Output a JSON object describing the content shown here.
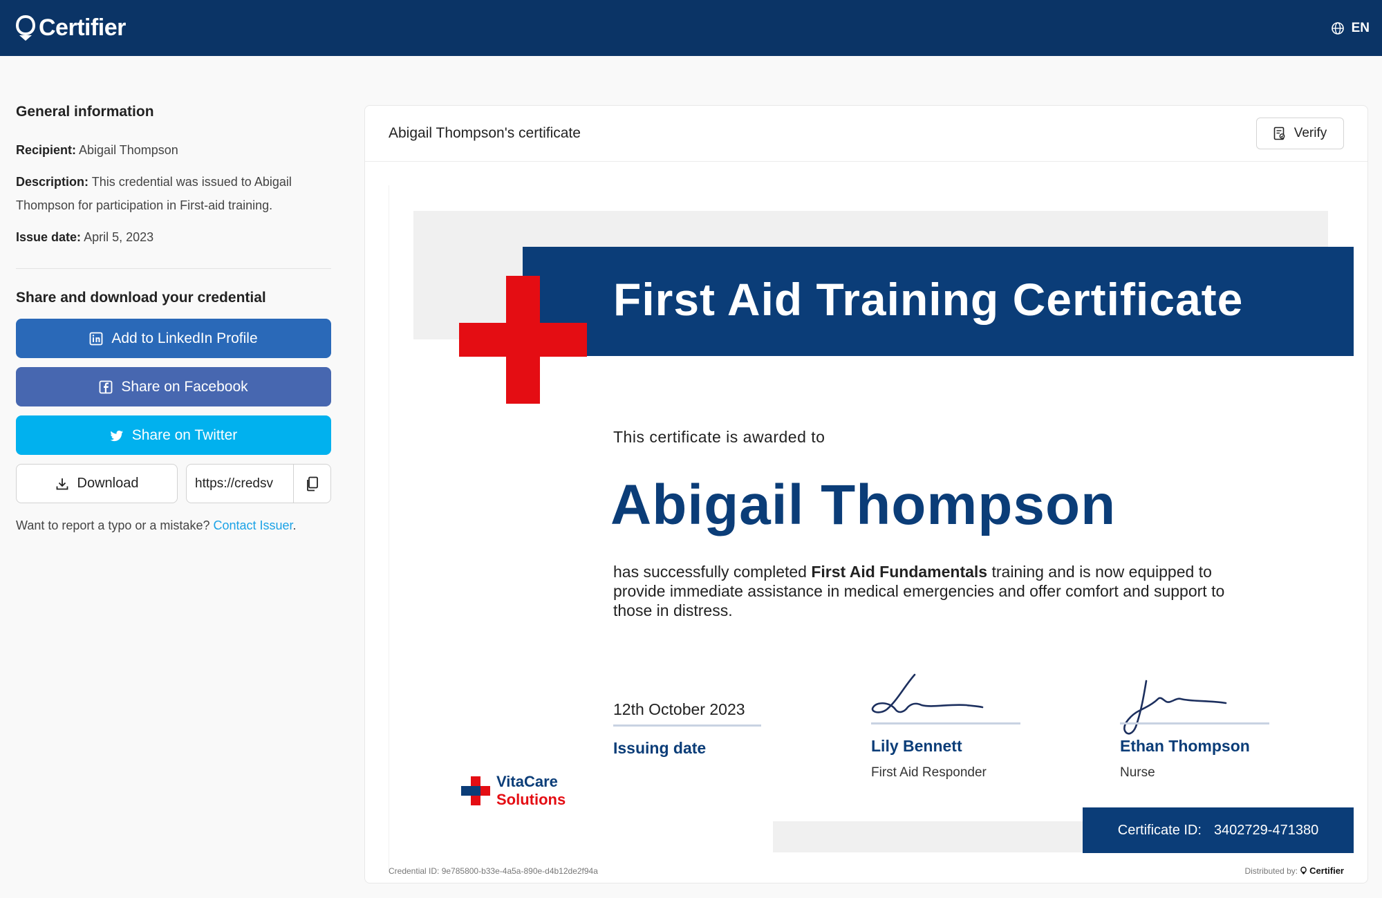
{
  "header": {
    "brand": "Certifier",
    "language": "EN",
    "icons": {
      "brand": "certifier-logo-icon",
      "language": "globe-icon"
    }
  },
  "general": {
    "title": "General information",
    "recipient_label": "Recipient:",
    "recipient_value": "Abigail Thompson",
    "description_label": "Description:",
    "description_value": "This credential was issued to Abigail Thompson for participation in First-aid training.",
    "issue_label": "Issue date:",
    "issue_value": "April 5, 2023"
  },
  "share": {
    "title": "Share and download your credential",
    "linkedin_label": "Add to LinkedIn Profile",
    "facebook_label": "Share on Facebook",
    "twitter_label": "Share on Twitter",
    "download_label": "Download",
    "url_value": "https://credsv",
    "report_text": "Want to report a typo or a mistake?",
    "report_link": "Contact Issuer",
    "report_suffix": "."
  },
  "card": {
    "title": "Abigail Thompson's certificate",
    "verify_label": "Verify"
  },
  "certificate": {
    "heading": "First Aid Training Certificate",
    "awarded": "This certificate is awarded to",
    "recipient": "Abigail Thompson",
    "body_pre": "has successfully completed ",
    "body_bold": "First Aid Fundamentals",
    "body_post": " training and is now equipped to provide immediate assistance in medical emergencies and offer comfort and support to those in distress.",
    "date_value": "12th October 2023",
    "date_label": "Issuing date",
    "signer1_name": "Lily Bennett",
    "signer1_role": "First Aid Responder",
    "signer2_name": "Ethan Thompson",
    "signer2_role": "Nurse",
    "logo_line1": "VitaCare",
    "logo_line2": "Solutions",
    "cert_id_label": "Certificate ID:",
    "cert_id_value": "3402729-471380",
    "credential_id": "Credential ID: 9e785800-b33e-4a5a-890e-d4b12de2f94a",
    "distributed_by": "Distributed by:",
    "distributed_brand": "Certifier"
  },
  "colors": {
    "navy": "#0b3466",
    "cert_blue": "#0b3d78",
    "red": "#e40d13",
    "linkedin": "#2a69b8",
    "facebook": "#4767b0",
    "twitter": "#01b1ee",
    "link": "#1ba2e6"
  }
}
